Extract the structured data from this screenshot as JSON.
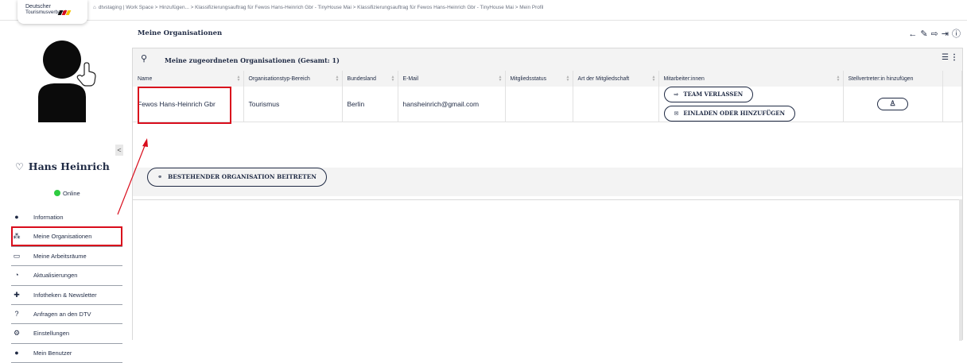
{
  "header": {
    "logo_line1": "Deutscher",
    "logo_line2": "Tourismusverband",
    "breadcrumb": "dtvstaging | Work Space > Hinzufügen... > Klassifizierungsauftrag für Fewos Hans-Heinrich Gbr - TinyHouse Mai > Klassifizierungsauftrag für Fewos Hans-Heinrich Gbr - TinyHouse Mai > Mein Profil"
  },
  "sidebar": {
    "collapse": "<",
    "profile_name": "Hans Heinrich",
    "status": "Online",
    "items": [
      {
        "label": "Information",
        "icon": "person-icon"
      },
      {
        "label": "Meine Organisationen",
        "icon": "org-chart-icon"
      },
      {
        "label": "Meine Arbeitsräume",
        "icon": "laptop-icon"
      },
      {
        "label": "Aktualisierungen",
        "icon": "rss-icon"
      },
      {
        "label": "Infotheken & Newsletter",
        "icon": "pin-icon"
      },
      {
        "label": "Anfragen an den DTV",
        "icon": "question-icon"
      },
      {
        "label": "Einstellungen",
        "icon": "gears-icon"
      },
      {
        "label": "Mein Benutzer",
        "icon": "user-settings-icon"
      }
    ]
  },
  "main": {
    "title": "Meine Organisationen",
    "card_title": "Meine zugeordneten Organisationen (Gesamt: 1)",
    "columns": [
      "Name",
      "Organisationstyp-Bereich",
      "Bundesland",
      "E-Mail",
      "Mitgliedsstatus",
      "Art der Mitgliedschaft",
      "Mitarbeiter:innen",
      "Stellvertreter:in hinzufügen"
    ],
    "rows": [
      {
        "name": "Fewos Hans-Heinrich Gbr",
        "type": "Tourismus",
        "state": "Berlin",
        "email": "hansheinrich@gmail.com",
        "status": "",
        "membership": "",
        "leave_team": "TEAM VERLASSEN",
        "invite": "EINLADEN ODER HINZUFÜGEN"
      }
    ],
    "join_button": "BESTEHENDER ORGANISATION BEITRETEN"
  },
  "colors": {
    "navy": "#1f2a44",
    "highlight": "#d90d1c",
    "online": "#2ecc40"
  }
}
